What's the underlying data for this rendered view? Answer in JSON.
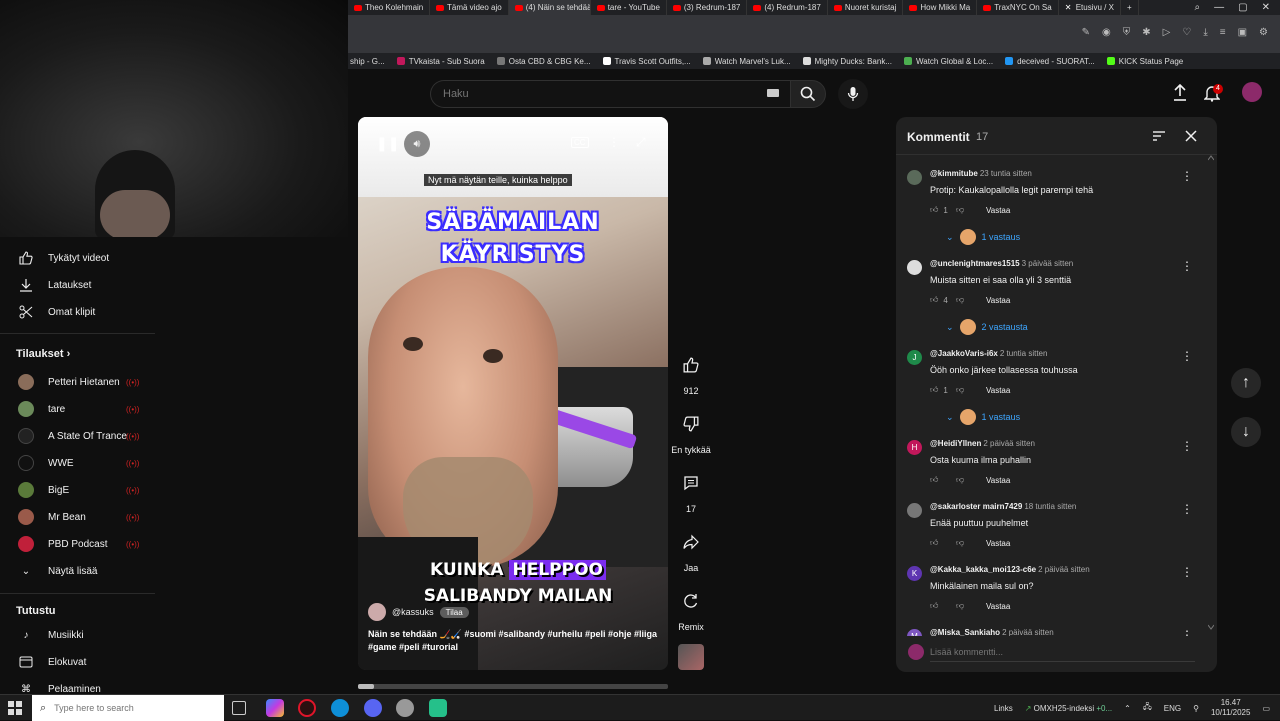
{
  "browser": {
    "tabs": [
      {
        "label": "Theo Kolehmain"
      },
      {
        "label": "Tämä video ajo"
      },
      {
        "label": "(4) Näin se tehdään",
        "active": true
      },
      {
        "label": "tare - YouTube"
      },
      {
        "label": "(3) Redrum-187"
      },
      {
        "label": "(4) Redrum-187"
      },
      {
        "label": "Nuoret kuristaj"
      },
      {
        "label": "How Mikki Ma"
      },
      {
        "label": "TraxNYC On Sa"
      },
      {
        "label": "Etusivu / X"
      }
    ],
    "bookmarks": [
      "ship - G...",
      "TVkaista - Sub Suora",
      "Osta CBD & CBG Ke...",
      "Travis Scott Outfits,...",
      "Watch Marvel's Luk...",
      "Mighty Ducks: Bank...",
      "Watch Global & Loc...",
      "deceived - SUORAT...",
      "KICK Status Page"
    ]
  },
  "header": {
    "search_placeholder": "Haku",
    "notification_count": "4"
  },
  "sidebar": {
    "top_items": [
      {
        "label": "Tykätyt videot",
        "icon": "thumbs-up-icon"
      },
      {
        "label": "Lataukset",
        "icon": "download-icon"
      },
      {
        "label": "Omat klipit",
        "icon": "scissors-icon"
      }
    ],
    "subscriptions_title": "Tilaukset",
    "subscriptions": [
      {
        "label": "Petteri Hietanen",
        "color": "#8a6d5a"
      },
      {
        "label": "tare",
        "color": "#6b8a5a"
      },
      {
        "label": "A State Of Trance",
        "color": "#222222"
      },
      {
        "label": "WWE",
        "color": "#111111"
      },
      {
        "label": "BigE",
        "color": "#5a7a3a"
      },
      {
        "label": "Mr Bean",
        "color": "#9a5a4a"
      },
      {
        "label": "PBD Podcast",
        "color": "#c0203a"
      }
    ],
    "show_more": "Näytä lisää",
    "explore_title": "Tutustu",
    "explore": [
      {
        "label": "Musiikki",
        "icon": "music-icon"
      },
      {
        "label": "Elokuvat",
        "icon": "film-icon"
      },
      {
        "label": "Pelaaminen",
        "icon": "gamepad-icon"
      }
    ]
  },
  "video": {
    "caption": "Nyt mä näytän teille, kuinka helppo",
    "overlay_title": [
      "SÄBÄMAILAN",
      "KÄYRISTYS"
    ],
    "overlay_bottom_plain": "KUINKA",
    "overlay_bottom_highlight": "HELPPOO",
    "overlay_bottom_line2": "SALIBANDY MAILAN",
    "channel": "@kassuks",
    "subscribe": "Tilaa",
    "description": "Näin se tehdään 🏒🏑 #suomi #salibandy #urheilu #peli #ohje #liiga #game #peli #turorial",
    "cc_label": "CC",
    "progress": 0.05
  },
  "actions": {
    "like_count": "912",
    "dislike_label": "En tykkää",
    "comment_count": "17",
    "share_label": "Jaa",
    "remix_label": "Remix"
  },
  "comments_panel": {
    "title": "Kommentit",
    "count": "17",
    "add_placeholder": "Lisää kommentti...",
    "reply_label": "Vastaa",
    "items": [
      {
        "user": "@kimmitube",
        "time": "23 tuntia sitten",
        "text": "Protip: Kaukalopallolla legit parempi tehä",
        "likes": "1",
        "replies": "1 vastaus",
        "avatar_color": "#5a6a5a",
        "avatar_letter": ""
      },
      {
        "user": "@unclenightmares1515",
        "time": "3 päivää sitten",
        "text": "Muista sitten ei saa olla yli 3 senttiä",
        "likes": "4",
        "replies": "2 vastausta",
        "avatar_color": "#dddddd",
        "avatar_letter": ""
      },
      {
        "user": "@JaakkoVaris-i6x",
        "time": "2 tuntia sitten",
        "text": "Ööh onko järkee tollasessa touhussa",
        "likes": "1",
        "replies": "1 vastaus",
        "avatar_color": "#1f8a4a",
        "avatar_letter": "J"
      },
      {
        "user": "@HeidiYllnen",
        "time": "2 päivää sitten",
        "text": "Osta kuuma ilma puhallin",
        "likes": "",
        "replies": "",
        "avatar_color": "#c2185b",
        "avatar_letter": "H"
      },
      {
        "user": "@sakarloster mairn7429",
        "time": "18 tuntia sitten",
        "text": "Enää puuttuu puuhelmet",
        "likes": "",
        "replies": "",
        "avatar_color": "#777777",
        "avatar_letter": ""
      },
      {
        "user": "@Kakka_kakka_moi123-c6e",
        "time": "2 päivää sitten",
        "text": "Minkälainen maila sul on?",
        "likes": "",
        "replies": "",
        "avatar_color": "#5e35b1",
        "avatar_letter": "K"
      },
      {
        "user": "@Miska_Sankiaho",
        "time": "2 päivää sitten",
        "text": "",
        "likes": "",
        "replies": "",
        "avatar_color": "#7e57c2",
        "avatar_letter": "M"
      }
    ]
  },
  "taskbar": {
    "search_placeholder": "Type here to search",
    "links_label": "Links",
    "stock_label": "OMXH25-indeksi",
    "stock_change": "+0...",
    "language": "ENG",
    "time": "16.47",
    "date": "10/11/2025"
  }
}
